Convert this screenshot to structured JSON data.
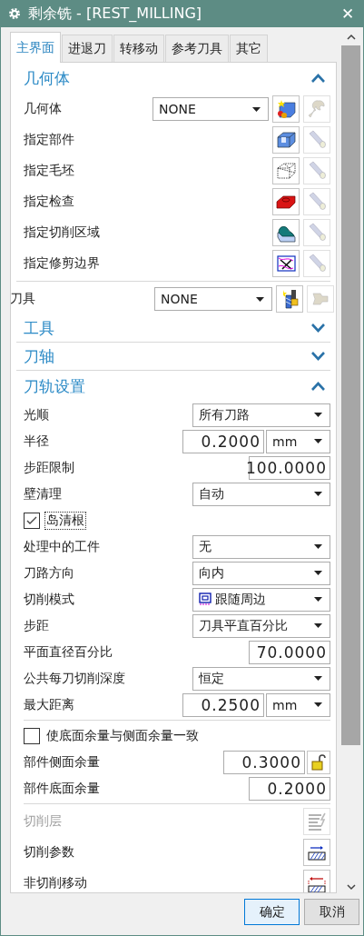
{
  "window": {
    "title": "剩余铣 - [REST_MILLING]",
    "close": "✕"
  },
  "tabs": [
    {
      "label": "主界面",
      "selected": true
    },
    {
      "label": "进退刀",
      "selected": false
    },
    {
      "label": "转移动",
      "selected": false
    },
    {
      "label": "参考刀具",
      "selected": false
    },
    {
      "label": "其它",
      "selected": false
    }
  ],
  "geometry": {
    "title": "几何体",
    "expanded": true,
    "select": {
      "label": "几何体",
      "value": "NONE"
    },
    "items": [
      {
        "label": "指定部件"
      },
      {
        "label": "指定毛坯"
      },
      {
        "label": "指定检查"
      },
      {
        "label": "指定切削区域"
      },
      {
        "label": "指定修剪边界"
      }
    ]
  },
  "tool": {
    "label": "刀具",
    "value": "NONE"
  },
  "collapsed_sections": [
    {
      "title": "工具",
      "expanded": false
    },
    {
      "title": "刀轴",
      "expanded": false
    }
  ],
  "path_settings": {
    "title": "刀轨设置",
    "expanded": true,
    "rows": [
      {
        "kind": "select",
        "label": "光顺",
        "value": "所有刀路"
      },
      {
        "kind": "number_unit",
        "label": "半径",
        "value": "0.2000",
        "unit": "mm"
      },
      {
        "kind": "number",
        "label": "步距限制",
        "value": "100.0000"
      },
      {
        "kind": "select",
        "label": "壁清理",
        "value": "自动"
      },
      {
        "kind": "checkbox",
        "label": "岛清根",
        "checked": true
      },
      {
        "kind": "select",
        "label": "处理中的工件",
        "value": "无"
      },
      {
        "kind": "select",
        "label": "刀路方向",
        "value": "向内"
      },
      {
        "kind": "select_icon",
        "label": "切削模式",
        "value": "跟随周边"
      },
      {
        "kind": "select",
        "label": "步距",
        "value": "刀具平直百分比"
      },
      {
        "kind": "number",
        "label": "平面直径百分比",
        "value": "70.0000"
      },
      {
        "kind": "select",
        "label": "公共每刀切削深度",
        "value": "恒定"
      },
      {
        "kind": "number_unit",
        "label": "最大距离",
        "value": "0.2500",
        "unit": "mm"
      }
    ]
  },
  "stock": [
    {
      "kind": "checkbox",
      "label": "使底面余量与侧面余量一致",
      "checked": false
    },
    {
      "kind": "number_lock",
      "label": "部件侧面余量",
      "value": "0.3000"
    },
    {
      "kind": "number",
      "label": "部件底面余量",
      "value": "0.2000"
    }
  ],
  "actions": [
    {
      "label": "切削层",
      "disabled": true
    },
    {
      "label": "切削参数",
      "disabled": false
    },
    {
      "label": "非切削移动",
      "disabled": false
    }
  ],
  "buttons": [
    {
      "label": "确定",
      "primary": true
    },
    {
      "label": "取消",
      "primary": false
    }
  ]
}
